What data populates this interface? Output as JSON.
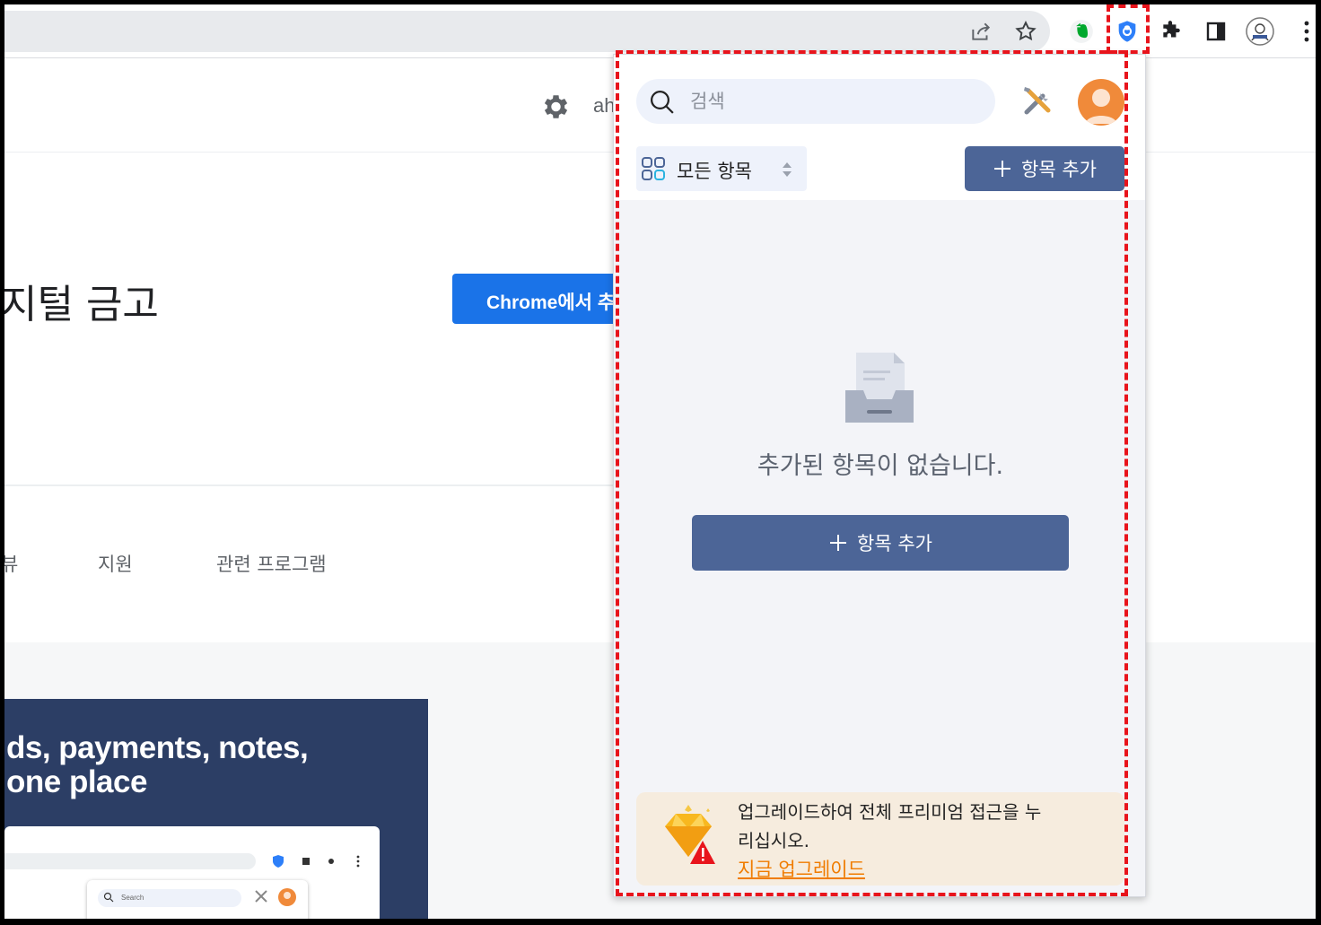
{
  "page": {
    "header_partial": "ah",
    "title_partial": "지털 금고",
    "chrome_button": "Chrome에서 추",
    "tabs": [
      "뷰",
      "지원",
      "관련 프로그램"
    ],
    "promo_line1": "ds, payments, notes,",
    "promo_line2": "one place",
    "mini_search": "Search"
  },
  "popup": {
    "search_placeholder": "검색",
    "filter_label": "모든 항목",
    "add_button": "항목 추가",
    "empty_message": "추가된 항목이 없습니다.",
    "add_main_button": "항목 추가",
    "upgrade_text": "업그레이드하여 전체 프리미엄 접근을 누리십시오.",
    "upgrade_link": "지금 업그레이드"
  },
  "colors": {
    "accent": "#4c6597",
    "highlight": "#e8141c",
    "upgrade_link": "#f07c00"
  }
}
